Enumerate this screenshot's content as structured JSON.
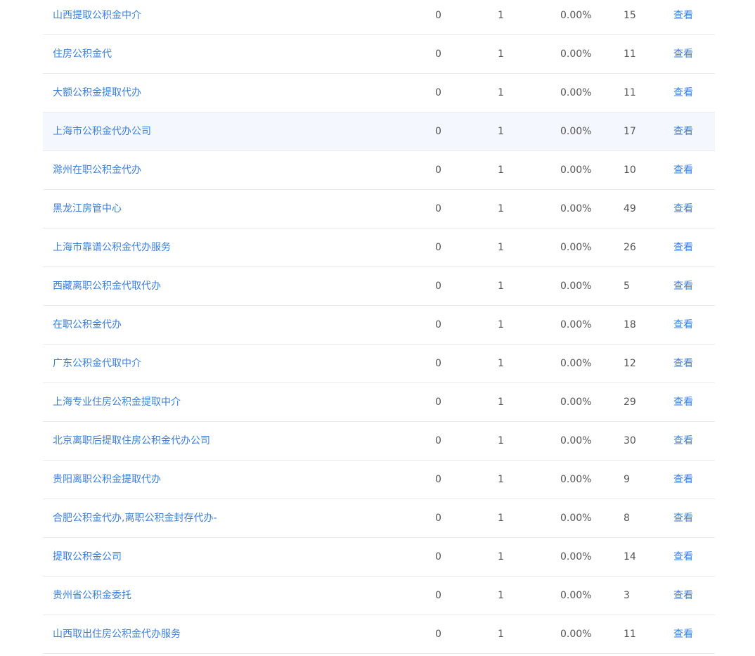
{
  "rows": [
    {
      "keyword": "山西提取公积金中介",
      "c1": "0",
      "c2": "1",
      "rate": "0.00%",
      "count": "15",
      "action": "查看"
    },
    {
      "keyword": "住房公积金代",
      "c1": "0",
      "c2": "1",
      "rate": "0.00%",
      "count": "11",
      "action": "查看"
    },
    {
      "keyword": "大额公积金提取代办",
      "c1": "0",
      "c2": "1",
      "rate": "0.00%",
      "count": "11",
      "action": "查看"
    },
    {
      "keyword": "上海市公积金代办公司",
      "c1": "0",
      "c2": "1",
      "rate": "0.00%",
      "count": "17",
      "action": "查看"
    },
    {
      "keyword": "滁州在职公积金代办",
      "c1": "0",
      "c2": "1",
      "rate": "0.00%",
      "count": "10",
      "action": "查看"
    },
    {
      "keyword": "黑龙江房管中心",
      "c1": "0",
      "c2": "1",
      "rate": "0.00%",
      "count": "49",
      "action": "查看"
    },
    {
      "keyword": "上海市靠谱公积金代办服务",
      "c1": "0",
      "c2": "1",
      "rate": "0.00%",
      "count": "26",
      "action": "查看"
    },
    {
      "keyword": "西藏离职公积金代取代办",
      "c1": "0",
      "c2": "1",
      "rate": "0.00%",
      "count": "5",
      "action": "查看"
    },
    {
      "keyword": "在职公积金代办",
      "c1": "0",
      "c2": "1",
      "rate": "0.00%",
      "count": "18",
      "action": "查看"
    },
    {
      "keyword": "广东公积金代取中介",
      "c1": "0",
      "c2": "1",
      "rate": "0.00%",
      "count": "12",
      "action": "查看"
    },
    {
      "keyword": "上海专业住房公积金提取中介",
      "c1": "0",
      "c2": "1",
      "rate": "0.00%",
      "count": "29",
      "action": "查看"
    },
    {
      "keyword": "北京离职后提取住房公积金代办公司",
      "c1": "0",
      "c2": "1",
      "rate": "0.00%",
      "count": "30",
      "action": "查看"
    },
    {
      "keyword": "贵阳离职公积金提取代办",
      "c1": "0",
      "c2": "1",
      "rate": "0.00%",
      "count": "9",
      "action": "查看"
    },
    {
      "keyword": "合肥公积金代办,离职公积金封存代办-",
      "c1": "0",
      "c2": "1",
      "rate": "0.00%",
      "count": "8",
      "action": "查看"
    },
    {
      "keyword": "提取公积金公司",
      "c1": "0",
      "c2": "1",
      "rate": "0.00%",
      "count": "14",
      "action": "查看"
    },
    {
      "keyword": "贵州省公积金委托",
      "c1": "0",
      "c2": "1",
      "rate": "0.00%",
      "count": "3",
      "action": "查看"
    },
    {
      "keyword": "山西取出住房公积金代办服务",
      "c1": "0",
      "c2": "1",
      "rate": "0.00%",
      "count": "11",
      "action": "查看"
    }
  ],
  "hover_row_index": 3,
  "colors": {
    "link": "#3c7fd8",
    "text": "#555555",
    "hover_bg": "#f4f7fd",
    "divider": "#ebebeb"
  }
}
